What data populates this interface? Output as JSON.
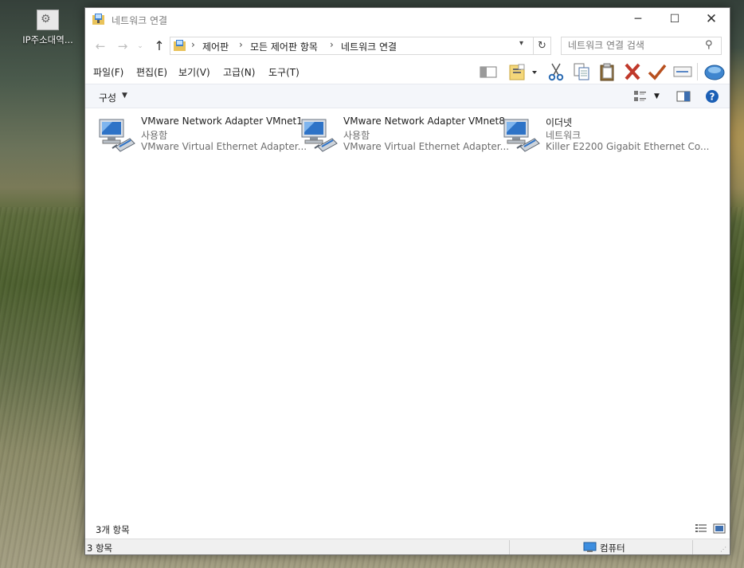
{
  "desktop": {
    "icon_label": "IP주소대역..."
  },
  "window": {
    "title": "네트워크 연결",
    "controls": {
      "minimize": "─",
      "maximize": "☐",
      "close": "✕"
    }
  },
  "nav": {
    "back": "←",
    "forward": "→",
    "recent": "⌄",
    "up": "↑",
    "breadcrumbs": [
      "제어판",
      "모든 제어판 항목",
      "네트워크 연결"
    ],
    "breadcrumb_sep": "›",
    "refresh": "↻",
    "search_placeholder": "네트워크 연결 검색"
  },
  "menu": {
    "items": [
      "파일(F)",
      "편집(E)",
      "보기(V)",
      "고급(N)",
      "도구(T)"
    ]
  },
  "toolbar": {
    "icons": [
      "preview-pane-icon",
      "folder-views-icon",
      "dropdown-icon",
      "cut-icon",
      "copy-icon",
      "paste-icon",
      "delete-icon",
      "properties-icon",
      "rename-icon",
      "web-icon"
    ]
  },
  "commandbar": {
    "organize": "구성"
  },
  "adapters": [
    {
      "name": "VMware Network Adapter VMnet1",
      "status": "사용함",
      "device": "VMware Virtual Ethernet Adapter..."
    },
    {
      "name": "VMware Network Adapter VMnet8",
      "status": "사용함",
      "device": "VMware Virtual Ethernet Adapter..."
    },
    {
      "name": "이더넷",
      "status": "네트워크",
      "device": "Killer E2200 Gigabit Ethernet Co..."
    }
  ],
  "status": {
    "item_count": "3개 항목",
    "bottom_items": "3 항목",
    "location": "컴퓨터"
  },
  "colors": {
    "cut": "#2c6cb3",
    "delete": "#c0392b",
    "check": "#b8501f",
    "help": "#1b5fb5"
  }
}
